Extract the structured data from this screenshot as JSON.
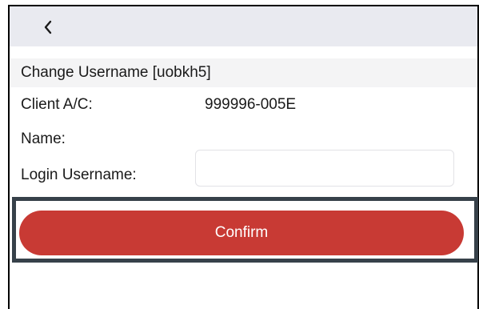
{
  "navbar": {
    "back_icon": "chevron-left-icon"
  },
  "section": {
    "title": "Change Username [uobkh5]"
  },
  "fields": {
    "client_ac_label": "Client A/C:",
    "client_ac_value": "999996-005E",
    "name_label": "Name:",
    "name_value": "",
    "login_username_label": "Login Username:",
    "login_username_value": "",
    "login_username_placeholder": ""
  },
  "actions": {
    "confirm_label": "Confirm"
  },
  "colors": {
    "navbar_bg": "#e9eaf0",
    "confirm_bg": "#c83a34",
    "highlight_border": "#37414a"
  }
}
